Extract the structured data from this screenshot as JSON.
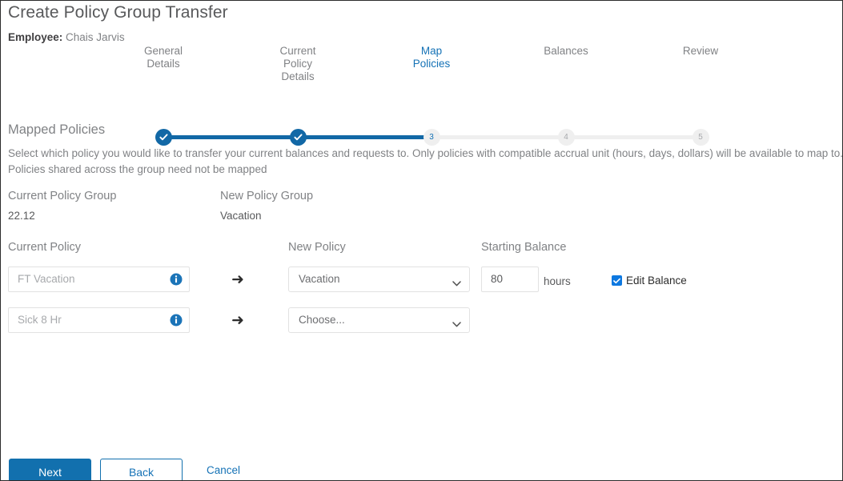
{
  "header": {
    "title": "Create Policy Group Transfer",
    "employee_label": "Employee:",
    "employee_name": "Chais Jarvis"
  },
  "stepper": {
    "steps": [
      {
        "label": "General\nDetails",
        "marker": "✓",
        "state": "done"
      },
      {
        "label": "Current\nPolicy\nDetails",
        "marker": "✓",
        "state": "done"
      },
      {
        "label": "Map\nPolicies",
        "marker": "3",
        "state": "current"
      },
      {
        "label": "Balances",
        "marker": "4",
        "state": "pending"
      },
      {
        "label": "Review",
        "marker": "5",
        "state": "pending"
      }
    ],
    "active_index": 2
  },
  "section": {
    "title": "Mapped Policies",
    "description": "Select which policy you would like to transfer your current balances and requests to. Only policies with compatible accrual unit (hours, days, dollars) will be available to map to. Policies shared across the group need not be mapped"
  },
  "policy_group": {
    "current_label": "Current Policy Group",
    "current_value": "22.12",
    "new_label": "New Policy Group",
    "new_value": "Vacation"
  },
  "table": {
    "headers": {
      "current_policy": "Current Policy",
      "new_policy": "New Policy",
      "starting_balance": "Starting Balance"
    },
    "rows": [
      {
        "current_policy": "FT Vacation",
        "info_icon": "info-icon",
        "arrow_icon": "arrow-right-icon",
        "new_policy": "Vacation",
        "balance": "80",
        "unit": "hours",
        "edit_balance_label": "Edit Balance",
        "edit_balance_checked": true
      },
      {
        "current_policy": "Sick 8 Hr",
        "info_icon": "info-icon",
        "arrow_icon": "arrow-right-icon",
        "new_policy": "Choose...",
        "balance": "",
        "unit": "",
        "edit_balance_label": "",
        "edit_balance_checked": false
      }
    ]
  },
  "footer": {
    "next_label": "Next",
    "back_label": "Back",
    "cancel_label": "Cancel"
  },
  "colors": {
    "primary_blue": "#1270ae",
    "step_done": "#1268a6",
    "link_blue": "#1572b6",
    "checkbox_blue": "#0d78e0",
    "text_grey": "#808285",
    "border_grey": "#e2e2e2"
  }
}
